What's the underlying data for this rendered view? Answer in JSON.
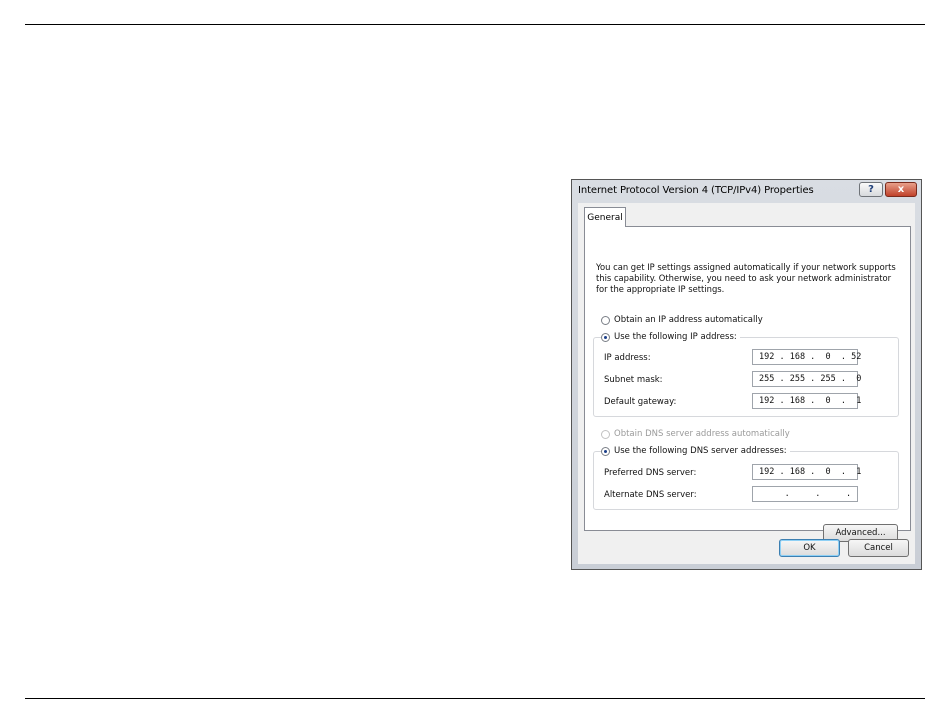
{
  "dialog": {
    "title": "Internet Protocol Version 4 (TCP/IPv4) Properties",
    "help_label": "?",
    "close_label": "x",
    "tab_label": "General",
    "description": "You can get IP settings assigned automatically if your network supports this capability. Otherwise, you need to ask your network administrator for the appropriate IP settings.",
    "ip_radio_auto": "Obtain an IP address automatically",
    "ip_radio_manual": "Use the following IP address:",
    "ip_fields": [
      {
        "label": "IP address:",
        "value": "192 . 168 .  0  . 52"
      },
      {
        "label": "Subnet mask:",
        "value": "255 . 255 . 255 .  0"
      },
      {
        "label": "Default gateway:",
        "value": "192 . 168 .  0  .  1"
      }
    ],
    "dns_radio_auto": "Obtain DNS server address automatically",
    "dns_radio_manual": "Use the following DNS server addresses:",
    "dns_fields": [
      {
        "label": "Preferred DNS server:",
        "value": "192 . 168 .  0  .  1"
      },
      {
        "label": "Alternate DNS server:",
        "value": "     .     .     ."
      }
    ],
    "advanced_label": "Advanced...",
    "ok_label": "OK",
    "cancel_label": "Cancel",
    "selected": {
      "ip_mode": "manual",
      "dns_mode": "manual"
    }
  }
}
